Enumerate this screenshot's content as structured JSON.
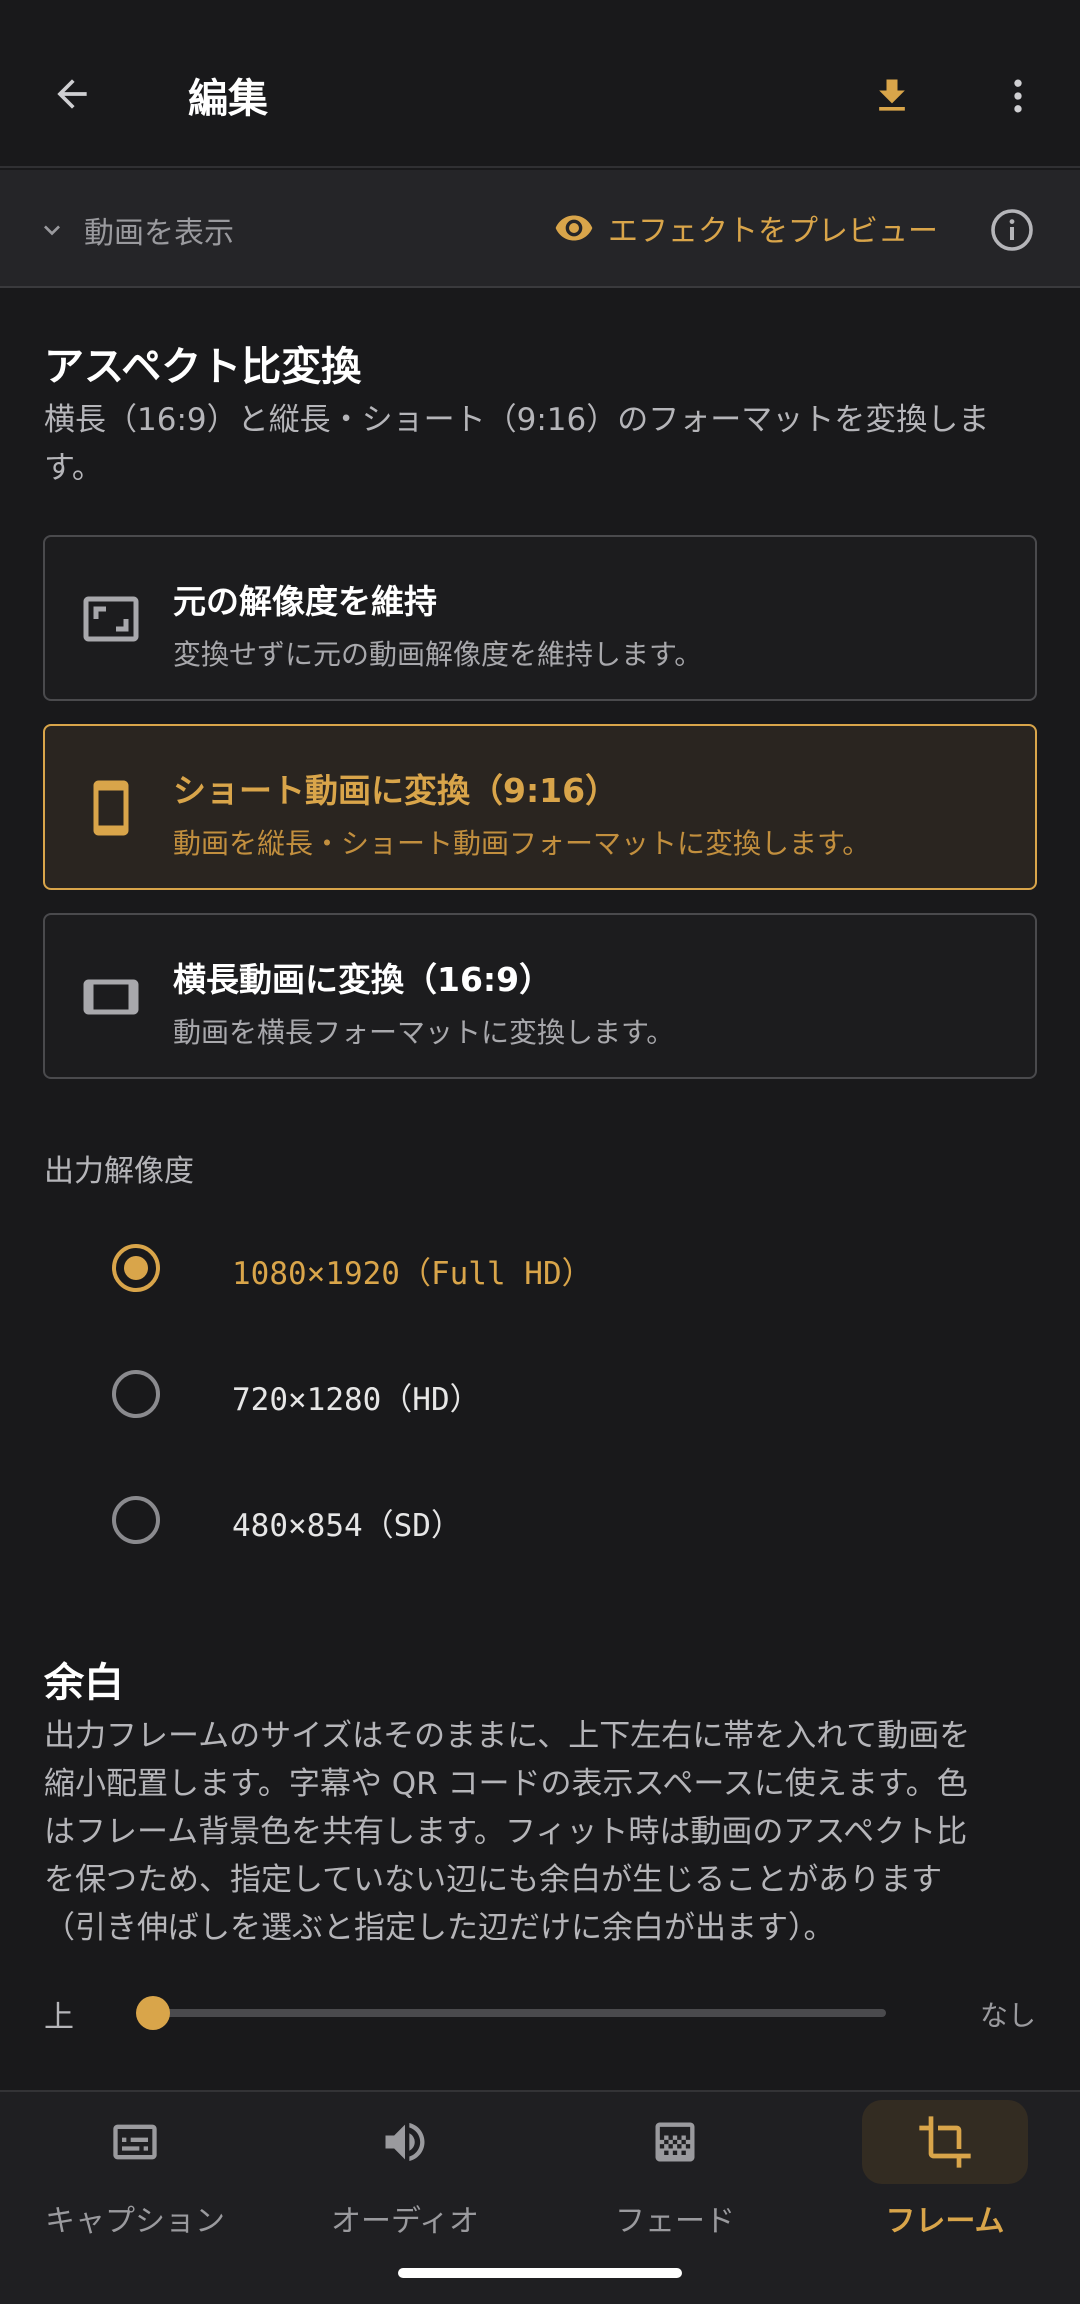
{
  "appbar": {
    "title": "編集"
  },
  "previewbar": {
    "show_video": "動画を表示",
    "preview_effect": "エフェクトをプレビュー"
  },
  "aspect": {
    "title": "アスペクト比変換",
    "desc_line1": "横長（16:9）と縦長・ショート（9:16）のフォーマットを変換しま",
    "desc_line2": "す。",
    "options": [
      {
        "title": "元の解像度を維持",
        "subtitle": "変換せずに元の動画解像度を維持します。",
        "icon": "aspect-ratio-icon",
        "selected": false
      },
      {
        "title": "ショート動画に変換（9:16）",
        "subtitle": "動画を縦長・ショート動画フォーマットに変換します。",
        "icon": "phone-portrait-icon",
        "selected": true
      },
      {
        "title": "横長動画に変換（16:9）",
        "subtitle": "動画を横長フォーマットに変換します。",
        "icon": "landscape-icon",
        "selected": false
      }
    ]
  },
  "resolution": {
    "label": "出力解像度",
    "options": [
      {
        "label": "1080×1920（Full HD）",
        "selected": true
      },
      {
        "label": "720×1280（HD）",
        "selected": false
      },
      {
        "label": "480×854（SD）",
        "selected": false
      }
    ]
  },
  "margin": {
    "title": "余白",
    "desc_lines": [
      "出力フレームのサイズはそのままに、上下左右に帯を入れて動画を",
      "縮小配置します。字幕や QR コードの表示スペースに使えます。色",
      "はフレーム背景色を共有します。フィット時は動画のアスペクト比",
      "を保つため、指定していない辺にも余白が生じることがあります",
      "（引き伸ばしを選ぶと指定した辺だけに余白が出ます）。"
    ],
    "slider": {
      "label": "上",
      "value_text": "なし",
      "fraction": 0.0
    }
  },
  "bottomnav": {
    "items": [
      {
        "label": "キャプション",
        "icon": "subtitles-icon",
        "active": false
      },
      {
        "label": "オーディオ",
        "icon": "speaker-icon",
        "active": false
      },
      {
        "label": "フェード",
        "icon": "gradient-icon",
        "active": false
      },
      {
        "label": "フレーム",
        "icon": "crop-icon",
        "active": true
      }
    ]
  },
  "colors": {
    "accent": "#d9a54a",
    "background": "#19191b"
  }
}
